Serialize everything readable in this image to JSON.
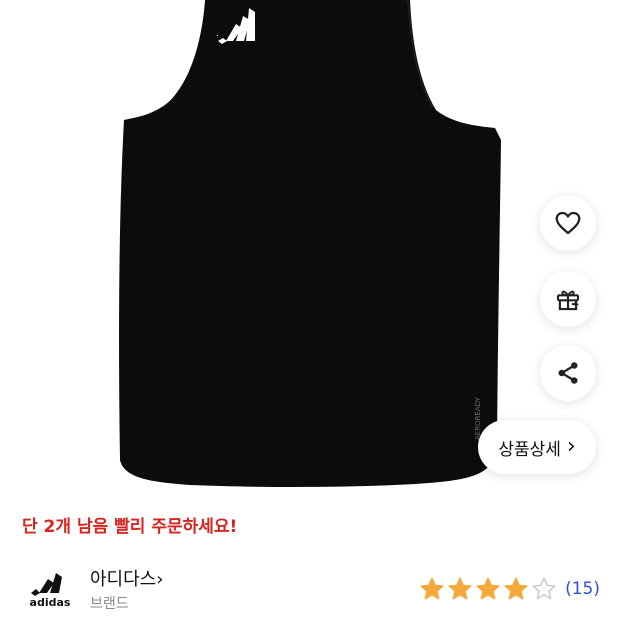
{
  "product": {
    "image_alt": "adidas black sleeveless tank top"
  },
  "actions": {
    "detail_label": "상품상세",
    "detail_chevron": "›"
  },
  "stock_message": "단 2개 남음 빨리 주문하세요!",
  "brand": {
    "name": "아디다스",
    "chevron": "›",
    "subtitle": "브랜드",
    "logo_text": "adidas"
  },
  "rating": {
    "stars_filled": 4,
    "stars_total": 5,
    "review_count": "(15)"
  },
  "colors": {
    "star": "#F5A93A",
    "stock_red": "#D6251F",
    "link_blue": "#2C4FD8"
  }
}
